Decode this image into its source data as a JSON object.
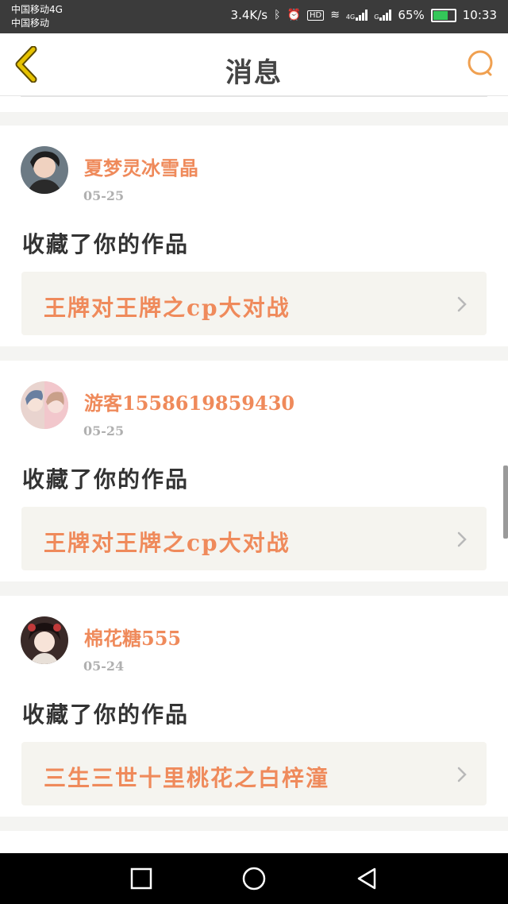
{
  "status_bar": {
    "carrier_1": "中国移动4G",
    "carrier_2": "中国移动",
    "speed": "3.4K/s",
    "hd": "HD",
    "net_1": "4G",
    "net_2": "G",
    "battery": "65%",
    "time": "10:33"
  },
  "header": {
    "title": "消息",
    "back_icon": "chevron-left-icon",
    "search_icon": "search-icon"
  },
  "messages": [
    {
      "user": "夏梦灵冰雪晶",
      "date": "05-25",
      "action": "收藏了你的作品",
      "work": "王牌对王牌之cp大对战"
    },
    {
      "user": "游客1558619859430",
      "date": "05-25",
      "action": "收藏了你的作品",
      "work": "王牌对王牌之cp大对战"
    },
    {
      "user": "棉花糖555",
      "date": "05-24",
      "action": "收藏了你的作品",
      "work": "三生三世十里桃花之白梓潼"
    }
  ],
  "colors": {
    "accent": "#ef8a5b",
    "back_icon": "#c9a400",
    "status_bar_bg": "#3b3b3b",
    "card_link_bg": "#f5f4ef"
  },
  "system_nav": {
    "recent_icon": "square-icon",
    "home_icon": "circle-icon",
    "back_icon": "triangle-back-icon"
  }
}
